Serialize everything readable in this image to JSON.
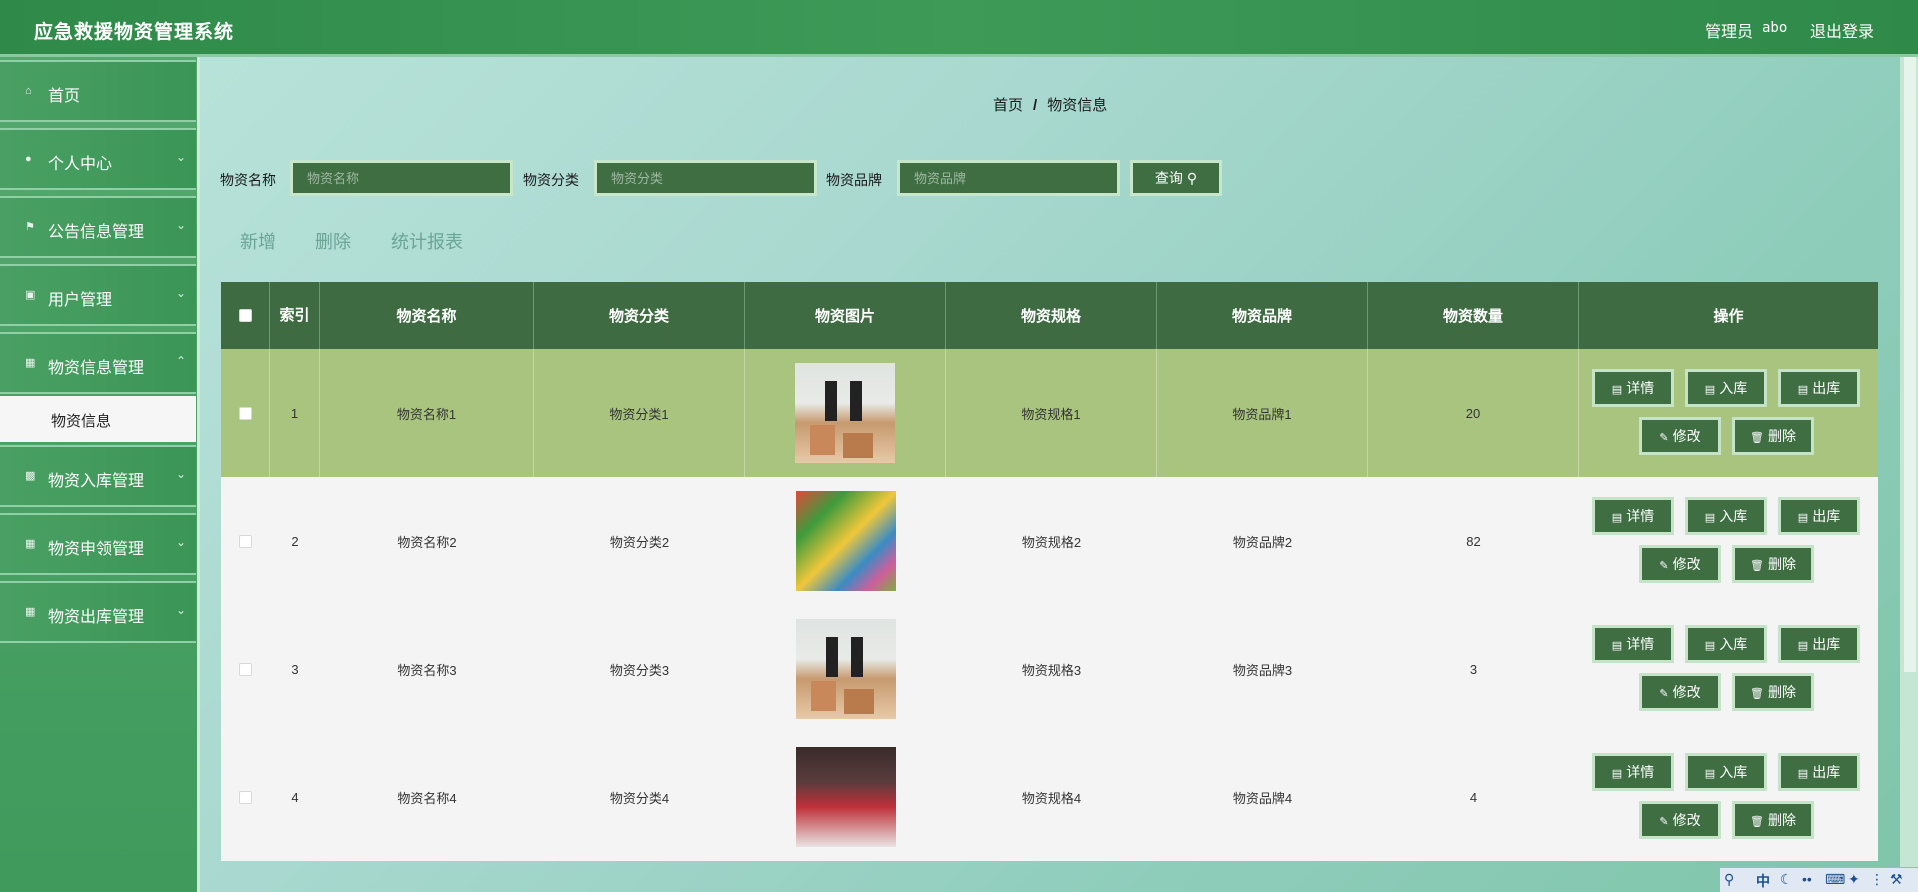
{
  "header": {
    "title": "应急救援物资管理系统",
    "role_label": "管理员",
    "username": "abo",
    "logout": "退出登录"
  },
  "sidebar": {
    "items": [
      {
        "label": "首页",
        "icon": "home-icon"
      },
      {
        "label": "个人中心",
        "icon": "user-icon"
      },
      {
        "label": "公告信息管理",
        "icon": "flag-icon"
      },
      {
        "label": "用户管理",
        "icon": "image-icon"
      },
      {
        "label": "物资信息管理",
        "icon": "grid-icon"
      },
      {
        "label": "物资入库管理",
        "icon": "chat-icon"
      },
      {
        "label": "物资申领管理",
        "icon": "grid-icon"
      },
      {
        "label": "物资出库管理",
        "icon": "grid-icon"
      }
    ],
    "active_sub": "物资信息"
  },
  "breadcrumb": {
    "home": "首页",
    "sep": "/",
    "current": "物资信息"
  },
  "search": {
    "name_label": "物资名称",
    "name_placeholder": "物资名称",
    "category_label": "物资分类",
    "category_placeholder": "物资分类",
    "brand_label": "物资品牌",
    "brand_placeholder": "物资品牌",
    "query_button": "查询"
  },
  "actions": {
    "add": "新增",
    "delete": "删除",
    "report": "统计报表"
  },
  "table": {
    "headers": {
      "index": "索引",
      "name": "物资名称",
      "category": "物资分类",
      "image": "物资图片",
      "spec": "物资规格",
      "brand": "物资品牌",
      "qty": "物资数量",
      "ops": "操作"
    },
    "row_buttons": {
      "detail": "详情",
      "in": "入库",
      "out": "出库",
      "edit": "修改",
      "del": "删除"
    },
    "rows": [
      {
        "index": "1",
        "name": "物资名称1",
        "category": "物资分类1",
        "spec": "物资规格1",
        "brand": "物资品牌1",
        "qty": "20",
        "image": "people-with-boxes"
      },
      {
        "index": "2",
        "name": "物资名称2",
        "category": "物资分类2",
        "spec": "物资规格2",
        "brand": "物资品牌2",
        "qty": "82",
        "image": "colorful-supplies"
      },
      {
        "index": "3",
        "name": "物资名称3",
        "category": "物资分类3",
        "spec": "物资规格3",
        "brand": "物资品牌3",
        "qty": "3",
        "image": "people-with-boxes"
      },
      {
        "index": "4",
        "name": "物资名称4",
        "category": "物资分类4",
        "spec": "物资规格4",
        "brand": "物资品牌4",
        "qty": "4",
        "image": "volunteers-red-vests"
      }
    ]
  },
  "ime": {
    "lang": "中"
  },
  "colors": {
    "header_green": "#2f8a4a",
    "button_green": "#3f6e43",
    "selected_row": "#a9c47f"
  }
}
